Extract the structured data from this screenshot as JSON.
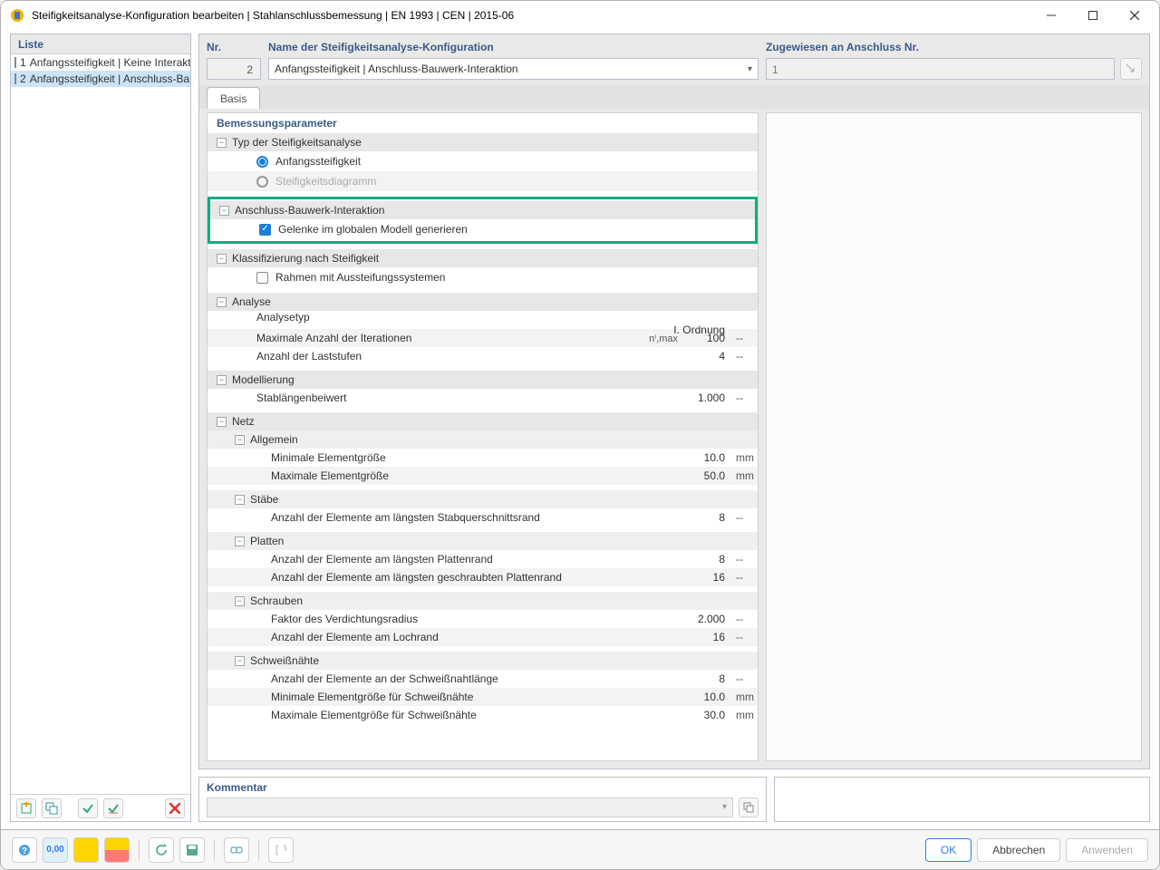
{
  "window": {
    "title": "Steifigkeitsanalyse-Konfiguration bearbeiten | Stahlanschlussbemessung | EN 1993 | CEN | 2015-06"
  },
  "left": {
    "header": "Liste",
    "items": [
      {
        "num": "1",
        "label": "Anfangssteifigkeit | Keine Interaktion mit Bauwerk"
      },
      {
        "num": "2",
        "label": "Anfangssteifigkeit | Anschluss-Bauwerk-Interaktion"
      }
    ]
  },
  "top": {
    "nr_label": "Nr.",
    "nr_value": "2",
    "name_label": "Name der Steifigkeitsanalyse-Konfiguration",
    "name_value": "Anfangssteifigkeit | Anschluss-Bauwerk-Interaktion",
    "assigned_label": "Zugewiesen an Anschluss Nr.",
    "assigned_value": "1"
  },
  "tabs": {
    "basis": "Basis"
  },
  "sections": {
    "bemess": "Bemessungsparameter",
    "typ": "Typ der Steifigkeitsanalyse",
    "opt1": "Anfangssteifigkeit",
    "opt2": "Steifigkeitsdiagramm",
    "absi": "Anschluss-Bauwerk-Interaktion",
    "absi_check": "Gelenke im globalen Modell generieren",
    "klass": "Klassifizierung nach Steifigkeit",
    "klass_check": "Rahmen mit Aussteifungssystemen",
    "analyse": "Analyse",
    "an_type": "Analysetyp",
    "an_type_v": "I. Ordnung",
    "an_maxiter": "Maximale Anzahl der Iterationen",
    "an_maxiter_sub": "nⁱ,max",
    "an_maxiter_v": "100",
    "an_stufen": "Anzahl der Laststufen",
    "an_stufen_v": "4",
    "model": "Modellierung",
    "stab_l": "Stablängenbeiwert",
    "stab_v": "1.000",
    "netz": "Netz",
    "allg": "Allgemein",
    "min_el": "Minimale Elementgröße",
    "min_el_v": "10.0",
    "max_el": "Maximale Elementgröße",
    "max_el_v": "50.0",
    "staebe": "Stäbe",
    "stab_row": "Anzahl der Elemente am längsten Stabquerschnittsrand",
    "stab_row_v": "8",
    "platten": "Platten",
    "plat1": "Anzahl der Elemente am längsten Plattenrand",
    "plat1_v": "8",
    "plat2": "Anzahl der Elemente am längsten geschraubten Plattenrand",
    "plat2_v": "16",
    "schrauben": "Schrauben",
    "sch1": "Faktor des Verdichtungsradius",
    "sch1_v": "2.000",
    "sch2": "Anzahl der Elemente am Lochrand",
    "sch2_v": "16",
    "schweiss": "Schweißnähte",
    "sw1": "Anzahl der Elemente an der Schweißnahtlänge",
    "sw1_v": "8",
    "sw2": "Minimale Elementgröße für Schweißnähte",
    "sw2_v": "10.0",
    "sw3": "Maximale Elementgröße für Schweißnähte",
    "sw3_v": "30.0",
    "u_dash": "--",
    "u_mm": "mm"
  },
  "comment": {
    "label": "Kommentar"
  },
  "footer": {
    "ok": "OK",
    "cancel": "Abbrechen",
    "apply": "Anwenden"
  }
}
